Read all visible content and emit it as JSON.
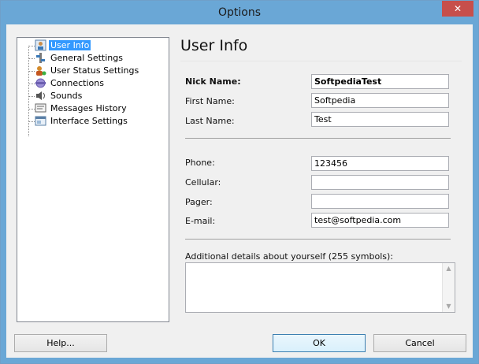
{
  "window": {
    "title": "Options",
    "close_label": "✕"
  },
  "tree": {
    "items": [
      {
        "label": "User Info",
        "icon": "user-info-icon",
        "selected": true
      },
      {
        "label": "General Settings",
        "icon": "general-settings-icon"
      },
      {
        "label": "User Status Settings",
        "icon": "user-status-icon"
      },
      {
        "label": "Connections",
        "icon": "connections-icon"
      },
      {
        "label": "Sounds",
        "icon": "sounds-icon"
      },
      {
        "label": "Messages History",
        "icon": "messages-history-icon"
      },
      {
        "label": "Interface Settings",
        "icon": "interface-settings-icon"
      }
    ]
  },
  "panel": {
    "title": "User Info",
    "nick_label": "Nick Name:",
    "nick_value": "SoftpediaTest",
    "first_label": "First Name:",
    "first_value": "Softpedia",
    "last_label": "Last Name:",
    "last_value": "Test",
    "phone_label": "Phone:",
    "phone_value": "123456",
    "cellular_label": "Cellular:",
    "cellular_value": "",
    "pager_label": "Pager:",
    "pager_value": "",
    "email_label": "E-mail:",
    "email_value": "test@softpedia.com",
    "details_label": "Additional details about yourself (255 symbols):",
    "details_value": ""
  },
  "buttons": {
    "help": "Help...",
    "ok": "OK",
    "cancel": "Cancel"
  },
  "colors": {
    "titlebar": "#6aa7d6",
    "selection": "#3399ff",
    "close": "#c74f4b"
  }
}
